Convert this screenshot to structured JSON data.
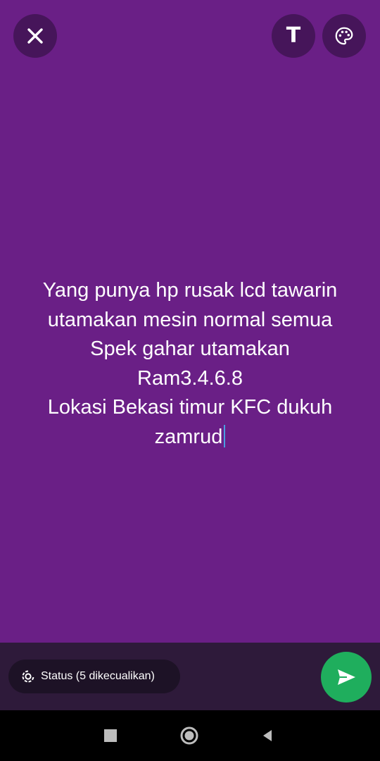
{
  "colors": {
    "background": "#6a1f86",
    "bottom_bar": "#2e1a3a",
    "send_button": "#1fae5d",
    "caret": "#4a9fe0"
  },
  "top_bar": {
    "close_icon": "close-icon",
    "text_tool_label": "T",
    "palette_icon": "palette-icon"
  },
  "status": {
    "lines": [
      "Yang punya hp rusak lcd tawarin",
      "utamakan mesin normal semua",
      "Spek gahar utamakan",
      "Ram3.4.6.8",
      "Lokasi Bekasi timur KFC dukuh",
      "zamrud"
    ]
  },
  "bottom_bar": {
    "audience_label": "Status (5 dikecualikan)",
    "audience_icon": "status-icon",
    "send_icon": "send-icon"
  },
  "nav": {
    "recents_icon": "recents-icon",
    "home_icon": "home-icon",
    "back_icon": "back-icon"
  }
}
